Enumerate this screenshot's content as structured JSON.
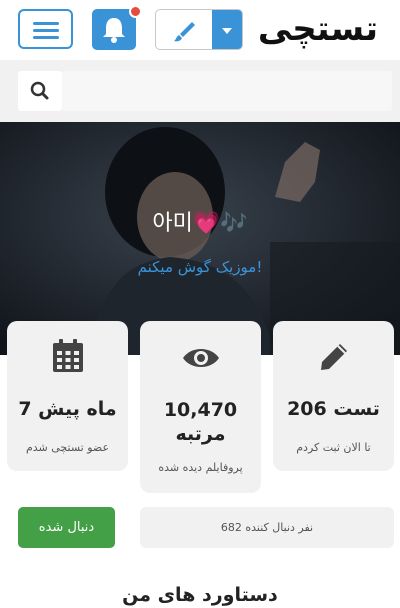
{
  "header": {
    "logo_text": "تستچی",
    "icons": [
      "menu-icon",
      "bell-icon",
      "paintbrush-icon",
      "caret-down-icon"
    ],
    "notification_badge": true,
    "accent_color": "#3a93d6",
    "badge_color": "#e74c3c"
  },
  "search": {
    "icon": "search-icon",
    "placeholder": ""
  },
  "profile": {
    "username": "아미💗🎶",
    "bio": "موزیک گوش میکنم!"
  },
  "stats": [
    {
      "icon": "pencil-icon",
      "value": "206 تست",
      "label": "تا الان ثبت کردم"
    },
    {
      "icon": "eye-icon",
      "value": "10,470 مرتبه",
      "label": "پروفایلم دیده شده"
    },
    {
      "icon": "calendar-icon",
      "value": "7 ماه پیش",
      "label": "عضو تستچی شدم"
    }
  ],
  "follow": {
    "button_label": "دنبال شده",
    "followers_text": "682 نفر دنبال کننده",
    "button_color": "#43a047"
  },
  "achievements": {
    "title": "دستاورد های من"
  }
}
